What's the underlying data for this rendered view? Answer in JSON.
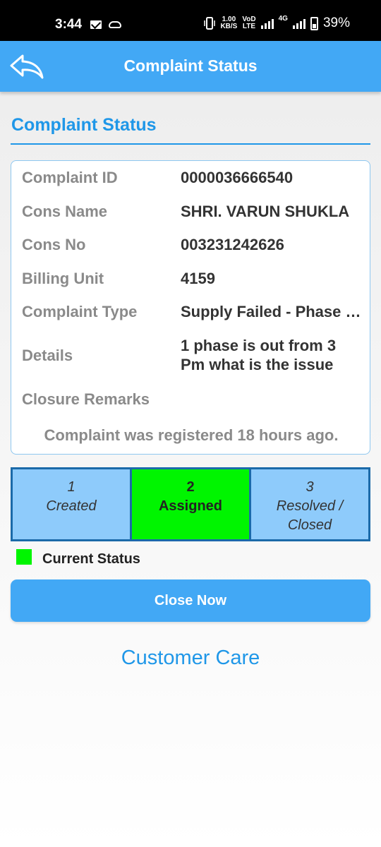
{
  "status_bar": {
    "time": "3:44",
    "net_speed_value": "1.00",
    "net_speed_unit": "KB/S",
    "volte_top": "VoD",
    "volte_bottom": "LTE",
    "network_type": "4G",
    "battery": "39%",
    "icons": [
      "mail-icon",
      "cloud-icon",
      "vibrate-icon",
      "signal-icon",
      "battery-icon"
    ]
  },
  "app_bar": {
    "title": "Complaint Status",
    "back_icon": "back-arrow-icon"
  },
  "section": {
    "title": "Complaint Status"
  },
  "details": {
    "rows": [
      {
        "label": "Complaint ID",
        "value": "0000036666540"
      },
      {
        "label": "Cons Name",
        "value": "SHRI. VARUN SHUKLA"
      },
      {
        "label": "Cons No",
        "value": "003231242626"
      },
      {
        "label": "Billing Unit",
        "value": "4159"
      },
      {
        "label": "Complaint Type",
        "value": "Supply Failed - Phase Failure"
      },
      {
        "label": "Details",
        "value": "1 phase is out from 3 Pm what is the issue"
      },
      {
        "label": "Closure Remarks",
        "value": ""
      }
    ],
    "registered_note": "Complaint was registered 18 hours ago."
  },
  "steps": [
    {
      "number": "1",
      "label": "Created",
      "current": false
    },
    {
      "number": "2",
      "label": "Assigned",
      "current": true
    },
    {
      "number": "3",
      "label": "Resolved / Closed",
      "current": false
    }
  ],
  "legend": {
    "label": "Current Status",
    "color": "#00f500"
  },
  "actions": {
    "close_label": "Close Now",
    "customer_care_label": "Customer Care"
  },
  "colors": {
    "primary": "#42a8f5",
    "heading": "#1f97e8",
    "step_default": "#8ecbfb",
    "step_current": "#00f500"
  }
}
